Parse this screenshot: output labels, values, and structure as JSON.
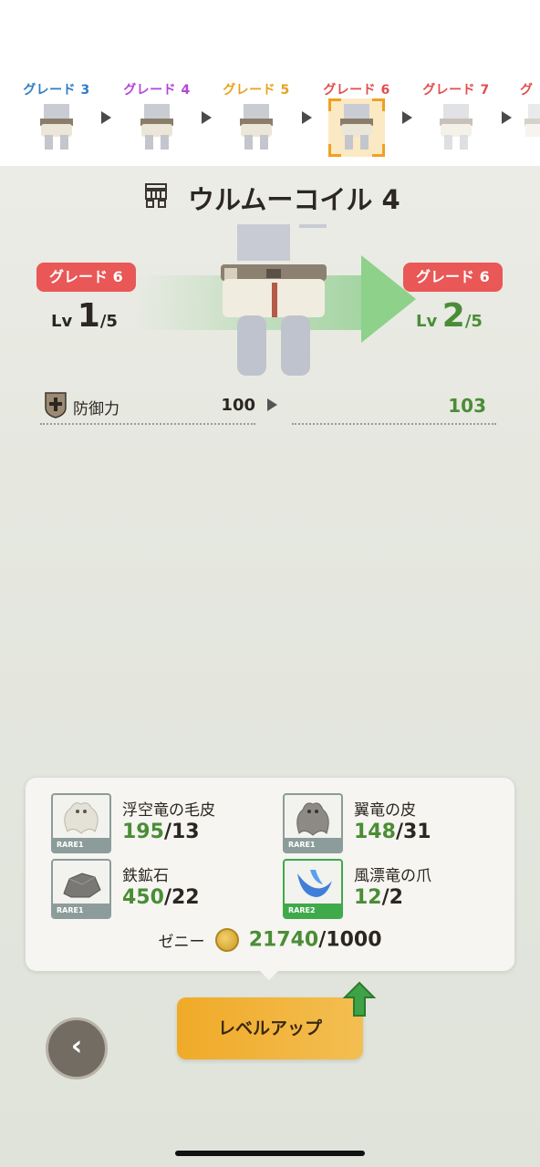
{
  "grades": [
    {
      "label": "グレード 3",
      "color": "#2f7cc6"
    },
    {
      "label": "グレード 4",
      "color": "#b246d6"
    },
    {
      "label": "グレード 5",
      "color": "#e8a21c"
    },
    {
      "label": "グレード 6",
      "color": "#e24d4d",
      "selected": true
    },
    {
      "label": "グレード 7",
      "color": "#e24d4d"
    },
    {
      "label": "グ",
      "color": "#e24d4d"
    }
  ],
  "item": {
    "name": "ウルムーコイル 4"
  },
  "current": {
    "grade": "グレード 6",
    "lv_label": "Lv",
    "lv": "1",
    "lv_max": "/5"
  },
  "next": {
    "grade": "グレード 6",
    "lv_label": "Lv",
    "lv": "2",
    "lv_max": "/5"
  },
  "stat": {
    "label": "防御力",
    "old": "100",
    "new": "103"
  },
  "materials": [
    {
      "name": "浮空竜の毛皮",
      "have": "195",
      "need": "/13",
      "rarity": "RARE1"
    },
    {
      "name": "翼竜の皮",
      "have": "148",
      "need": "/31",
      "rarity": "RARE1"
    },
    {
      "name": "鉄鉱石",
      "have": "450",
      "need": "/22",
      "rarity": "RARE1"
    },
    {
      "name": "風漂竜の爪",
      "have": "12",
      "need": "/2",
      "rarity": "RARE2"
    }
  ],
  "zeny": {
    "label": "ゼニー",
    "have": "21740",
    "need": "/1000"
  },
  "buttons": {
    "level_up": "レベルアップ",
    "back": "‹"
  }
}
